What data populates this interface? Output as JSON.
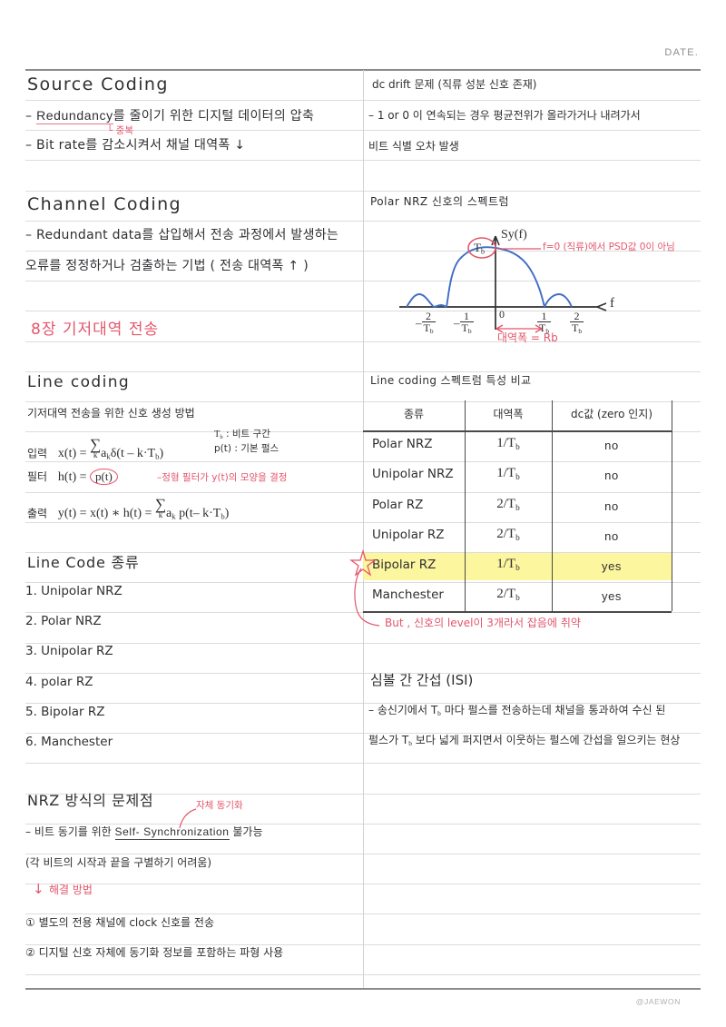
{
  "header": {
    "date_label": "DATE."
  },
  "footer": {
    "signature": "@JAEWON"
  },
  "colors": {
    "ink": "#2f2f33",
    "red": "#e3566b",
    "blue": "#3f6fc4",
    "highlight": "#fbf48d",
    "rule": "#dcdcdc"
  },
  "left_column": {
    "source_coding": {
      "title": "Source   Coding",
      "line1_pre": "– ",
      "line1_term": "Redundancy",
      "line1_post": "를   줄이기   위한   디지털   데이터의    압축",
      "annotation": "└ 중복",
      "line2": "– Bit rate를  감소시켜서  채널  대역폭 ↓"
    },
    "channel_coding": {
      "title": "Channel    Coding",
      "line1": "– Redundant  data를   삽입해서   전송  과정에서   발생하는",
      "line2": "오류를   정정하거나   검출하는   기법 ( 전송  대역폭 ↑ )"
    },
    "chapter_banner": "8장    기저대역    전송",
    "line_coding": {
      "title": "Line  coding",
      "subtitle": "기저대역   전송을   위한   신호   생성   방법",
      "input_label": "입력",
      "input_eq_a": "x(t) = ",
      "input_eq_sum": "∑",
      "input_eq_k": "k",
      "input_eq_b": "a",
      "input_eq_b_sub": "k",
      "input_eq_c": "δ(t – k·T",
      "input_eq_c_sub": "b",
      "input_eq_c_end": ")",
      "note_tb": "T",
      "note_tb_sub": "b",
      "note_tb_txt": " : 비트   구간",
      "note_pt": "p(t) : 기본   펄스",
      "filter_label": "필터",
      "filter_eq": "h(t) = ",
      "filter_circled": "p(t)",
      "filter_note": "–정형  필터가  y(t)의  모양을   결정",
      "output_label": "출력",
      "output_eq_a": "y(t) = x(t) ∗ h(t)  = ",
      "output_eq_sum": "∑",
      "output_eq_k": "k",
      "output_eq_b": "a",
      "output_eq_b_sub": "k",
      "output_eq_c": " p(t– k·T",
      "output_eq_c_sub": "b",
      "output_eq_c_end": ")"
    },
    "line_code_list": {
      "title": "Line  Code   종류",
      "items": [
        "1. Unipolar  NRZ",
        "2. Polar  NRZ",
        "3. Unipolar  RZ",
        "4. polar  RZ",
        "5. Bipolar  RZ",
        "6. Manchester"
      ]
    },
    "nrz_problem": {
      "title": "NRZ  방식의  문제점",
      "line1_pre": "– 비트  동기를  위한   ",
      "line1_term": "Self- Synchronization",
      "line1_post": "  불가능",
      "annotation": "자체  동기화",
      "line2": "(각  비트의   시작과  끝을  구별하기   어려움)",
      "solution_label": "해결  방법",
      "solution_arrow": "↓",
      "item1": "① 별도의   전용  채널에    clock  신호를  전송",
      "item2": "② 디지털  신호  자체에  동기화  정보를  포함하는   파형  사용"
    }
  },
  "right_column": {
    "dc_drift": {
      "title": "dc  drift 문제 (직류 성분 신호 존재)",
      "line1": "– 1 or 0 이  연속되는  경우  평균전위가   올라가거나   내려가서",
      "line2": "비트  식별  오차  발생"
    },
    "spectrum": {
      "title": "Polar  NRZ  신호의  스펙트럼",
      "axis_y_label": "Sy(f)",
      "axis_x_label": "f",
      "peak_label": "Tb",
      "origin_label": "0",
      "ticks": [
        {
          "num": "2",
          "den": "Tb",
          "sign": "–"
        },
        {
          "num": "1",
          "den": "Tb",
          "sign": "–"
        },
        {
          "num": "1",
          "den": "Tb",
          "sign": ""
        },
        {
          "num": "2",
          "den": "Tb",
          "sign": ""
        }
      ],
      "annotation_psd": "f=0 (직류)에서   PSD값  0이   아님",
      "annotation_bw": "대역폭 = Rb"
    },
    "table": {
      "caption": "Line  coding  스펙트럼  특성  비교",
      "headers": [
        "종류",
        "대역폭",
        "dc값 (zero 인지)"
      ],
      "rows": [
        {
          "name": "Polar   NRZ",
          "bw_num": "1",
          "bw_den": "Tb",
          "dc": "no",
          "highlight": false
        },
        {
          "name": "Unipolar  NRZ",
          "bw_num": "1",
          "bw_den": "Tb",
          "dc": "no",
          "highlight": false
        },
        {
          "name": "Polar    RZ",
          "bw_num": "2",
          "bw_den": "Tb",
          "dc": "no",
          "highlight": false
        },
        {
          "name": "Unipolar  RZ",
          "bw_num": "2",
          "bw_den": "Tb",
          "dc": "no",
          "highlight": false
        },
        {
          "name": "Bipolar   RZ",
          "bw_num": "1",
          "bw_den": "Tb",
          "dc": "yes",
          "highlight": true
        },
        {
          "name": "Manchester",
          "bw_num": "2",
          "bw_den": "Tb",
          "dc": "yes",
          "highlight": false
        }
      ],
      "note": "But ,  신호의  level이  3개라서  잡음에  취약"
    },
    "isi": {
      "title": "심볼 간  간섭 (ISI)",
      "line1": "– 송신기에서  T",
      "line1_sub": "b",
      "line1_b": " 마다  펄스를  전송하는데  채널을  통과하여  수신 된",
      "line2": "펄스가  T",
      "line2_sub": "b",
      "line2_b": " 보다  넓게  퍼지면서  이웃하는  펄스에  간섭을  일으키는  현상"
    }
  }
}
